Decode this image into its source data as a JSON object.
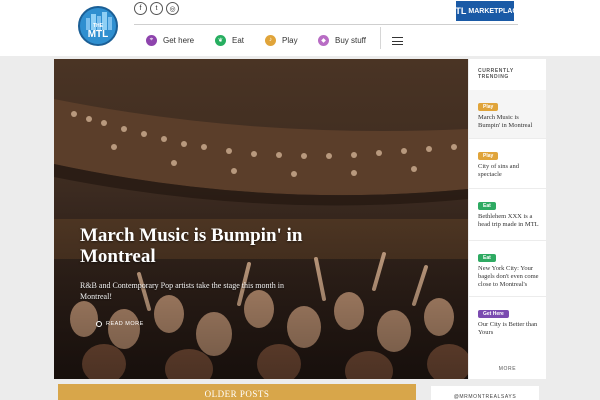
{
  "header": {
    "logo": {
      "small_text": "THE",
      "big_text": "MTL"
    },
    "socials": [
      {
        "icon": "facebook-icon",
        "glyph": "f"
      },
      {
        "icon": "twitter-icon",
        "glyph": "t"
      },
      {
        "icon": "instagram-icon",
        "glyph": "◎"
      }
    ],
    "nav": [
      {
        "label": "Get here",
        "icon": "location-pin-icon",
        "color": "#8e44ad",
        "glyph": "⌖"
      },
      {
        "label": "Eat",
        "icon": "leaf-icon",
        "color": "#27ae60",
        "glyph": "❦"
      },
      {
        "label": "Play",
        "icon": "play-icon",
        "color": "#e0a43a",
        "glyph": "♪"
      },
      {
        "label": "Buy stuff",
        "icon": "shopping-bag-icon",
        "color": "#b86cc4",
        "glyph": "◆"
      }
    ],
    "marketplace": {
      "brand": "MTL",
      "label": "MARKETPLACE"
    }
  },
  "hero": {
    "title": "March Music is Bumpin' in Montreal",
    "subtitle": "R&B and Contemporary Pop artists take the stage this month in Montreal!",
    "read_more": "READ MORE"
  },
  "trending": {
    "heading_line1": "CURRENTLY",
    "heading_line2": "TRENDING",
    "items": [
      {
        "badge": "Play",
        "badge_color": "#e0a43a",
        "text": "March Music is Bumpin' in Montreal"
      },
      {
        "badge": "Play",
        "badge_color": "#e0a43a",
        "text": "City of sins and spectacle"
      },
      {
        "badge": "Eat",
        "badge_color": "#2eaa62",
        "text": "Bethlehem XXX is a head trip made in MTL"
      },
      {
        "badge": "Eat",
        "badge_color": "#2eaa62",
        "text": "New York City: Your bagels don't even come close to Montreal's"
      },
      {
        "badge": "Get Here",
        "badge_color": "#7b4bb0",
        "text": "Our City is Better than Yours"
      }
    ],
    "more": "MORE"
  },
  "footer": {
    "older_posts": "OLDER POSTS",
    "handle": "@MRMONTREALSAYS"
  }
}
